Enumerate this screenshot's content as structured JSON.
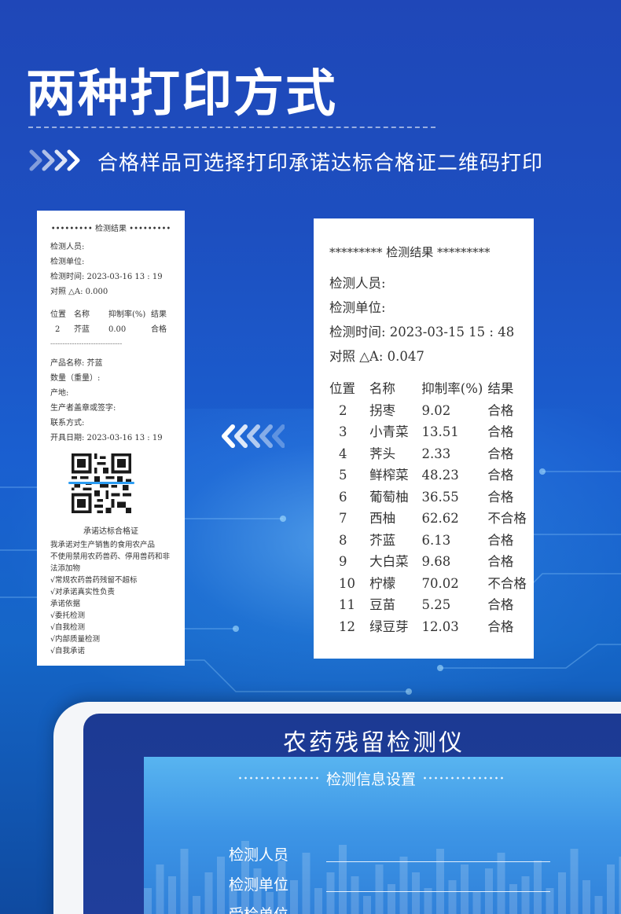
{
  "header": {
    "title": "两种打印方式",
    "subtitle": "合格样品可选择打印承诺达标合格证二维码打印"
  },
  "receipt_small": {
    "header": "•••••••••  检测结果  •••••••••",
    "inspector": "检测人员:",
    "unit": "检测单位:",
    "time": "检测时间:  2023-03-16    13 : 19",
    "control": "对照 △A:  0.000",
    "columns": [
      "位置",
      "名称",
      "抑制率(%)",
      "结果"
    ],
    "rows": [
      [
        "2",
        "芥蓝",
        "0.00",
        "合格"
      ]
    ],
    "separator": "------------------------------",
    "product": "产品名称:  芥蓝",
    "quantity": "数量（重量）:",
    "origin": "产地:",
    "producer_sign": "生产者盖章或签字:",
    "contact": "联系方式:",
    "issue_date": "开具日期:  2023-03-16    13 : 19",
    "promise_title": "承诺达标合格证",
    "promise_lines": [
      "我承诺对生产销售的食用农产品",
      "不使用禁用农药兽药、停用兽药和非",
      "法添加物",
      "√常规农药兽药残留不超标",
      "√对承诺真实性负责",
      "承诺依据",
      "√委托检测",
      "√自我检测",
      "√内部质量检测",
      "√自我承诺"
    ]
  },
  "receipt_large": {
    "header": "*********  检测结果  *********",
    "inspector": "检测人员:",
    "unit": "检测单位:",
    "time": "检测时间:  2023-03-15    15 : 48",
    "control": "对照 △A:  0.047",
    "columns": [
      "位置",
      "名称",
      "抑制率(%)",
      "结果"
    ],
    "rows": [
      [
        "2",
        "拐枣",
        "9.02",
        "合格"
      ],
      [
        "3",
        "小青菜",
        "13.51",
        "合格"
      ],
      [
        "4",
        "荠头",
        "2.33",
        "合格"
      ],
      [
        "5",
        "鲜榨菜",
        "48.23",
        "合格"
      ],
      [
        "6",
        "葡萄柚",
        "36.55",
        "合格"
      ],
      [
        "7",
        "西柚",
        "62.62",
        "不合格"
      ],
      [
        "8",
        "芥蓝",
        "6.13",
        "合格"
      ],
      [
        "9",
        "大白菜",
        "9.68",
        "合格"
      ],
      [
        "10",
        "柠檬",
        "70.02",
        "不合格"
      ],
      [
        "11",
        "豆苗",
        "5.25",
        "合格"
      ],
      [
        "12",
        "绿豆芽",
        "12.03",
        "合格"
      ]
    ]
  },
  "device": {
    "title": "农药残留检测仪",
    "screen_title": "检测信息设置",
    "fields": [
      "检测人员",
      "检测单位",
      "受检单位"
    ]
  },
  "colors": {
    "background": "#1d4fc0",
    "accent_scan": "#2b9cf2",
    "screen": "#3d95e6"
  }
}
